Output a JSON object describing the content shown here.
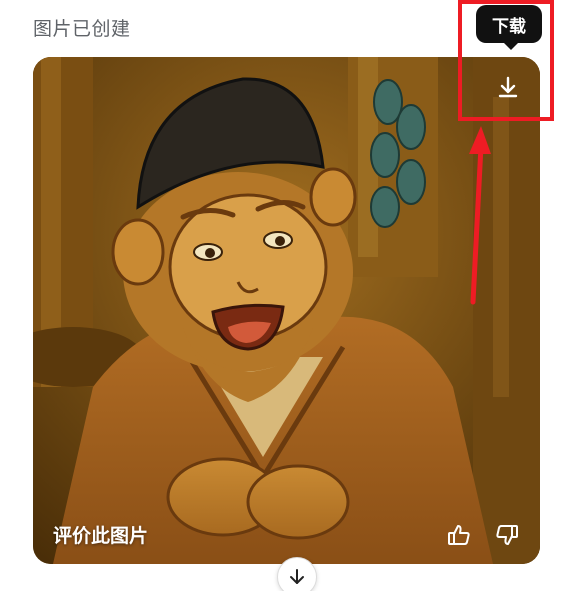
{
  "header": {
    "status_text": "图片已创建"
  },
  "image_card": {
    "rate_label": "评价此图片",
    "download_icon": "download-icon",
    "thumbs_up_icon": "thumbs-up-icon",
    "thumbs_down_icon": "thumbs-down-icon"
  },
  "tooltip": {
    "label": "下载"
  },
  "annotation": {
    "highlight_color": "#ee1c24"
  },
  "footer": {
    "scroll_icon": "arrow-down-icon"
  }
}
